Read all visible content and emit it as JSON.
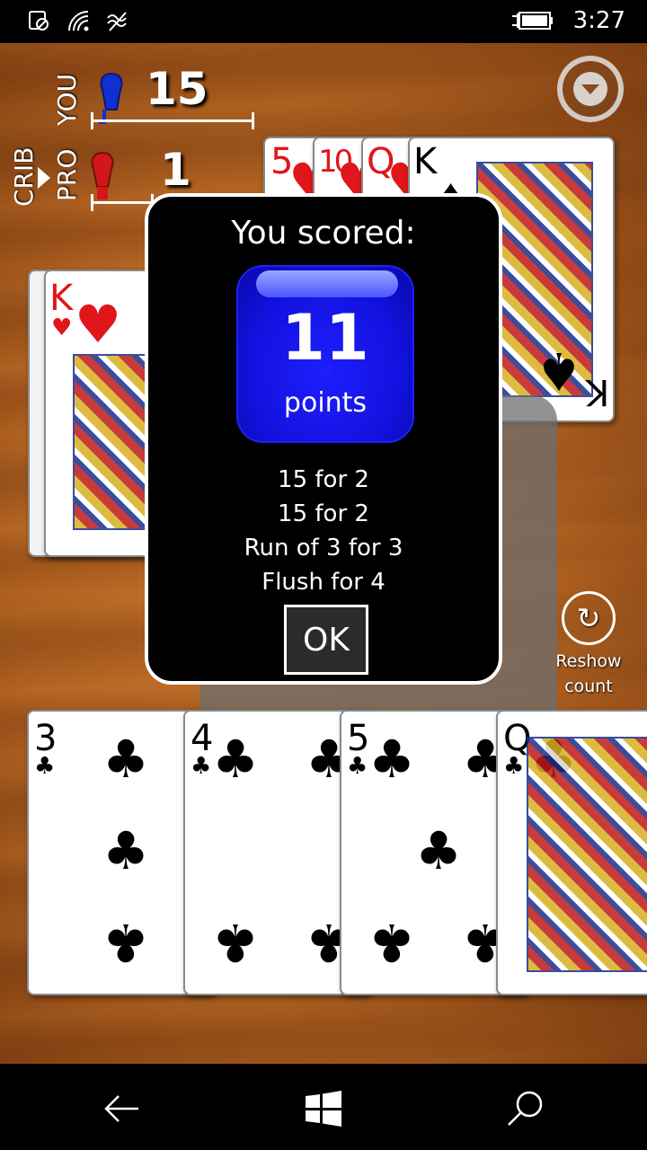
{
  "status_bar": {
    "time": "3:27",
    "icons": [
      "alarm-off-icon",
      "wifi-icon",
      "signal-icon",
      "battery-charging-icon"
    ]
  },
  "scoreboard": {
    "player_label": "YOU",
    "player_score": "15",
    "opponent_label": "PRO",
    "opponent_score": "1",
    "crib_label": "CRIB",
    "player_peg_color": "#1030d0",
    "opponent_peg_color": "#d01818"
  },
  "crib_hand": [
    {
      "rank": "5",
      "suit": "♥"
    },
    {
      "rank": "10",
      "suit": "♥"
    },
    {
      "rank": "Q",
      "suit": "♥"
    },
    {
      "rank": "K",
      "suit": "♠"
    }
  ],
  "starter_cards": [
    {
      "rank": "K",
      "suit": "♥"
    }
  ],
  "player_hand": [
    {
      "rank": "3",
      "suit": "♣"
    },
    {
      "rank": "4",
      "suit": "♣"
    },
    {
      "rank": "5",
      "suit": "♣"
    },
    {
      "rank": "Q",
      "suit": "♣"
    }
  ],
  "dialog": {
    "title": "You scored:",
    "points": "11",
    "points_unit": "points",
    "breakdown": [
      "15 for 2",
      "15 for 2",
      "Run of 3 for 3",
      "Flush for 4"
    ],
    "ok_label": "OK"
  },
  "reshow": {
    "line1": "Reshow",
    "line2": "count"
  },
  "nav_bar": {
    "icons": [
      "back-icon",
      "windows-start-icon",
      "search-icon"
    ]
  }
}
